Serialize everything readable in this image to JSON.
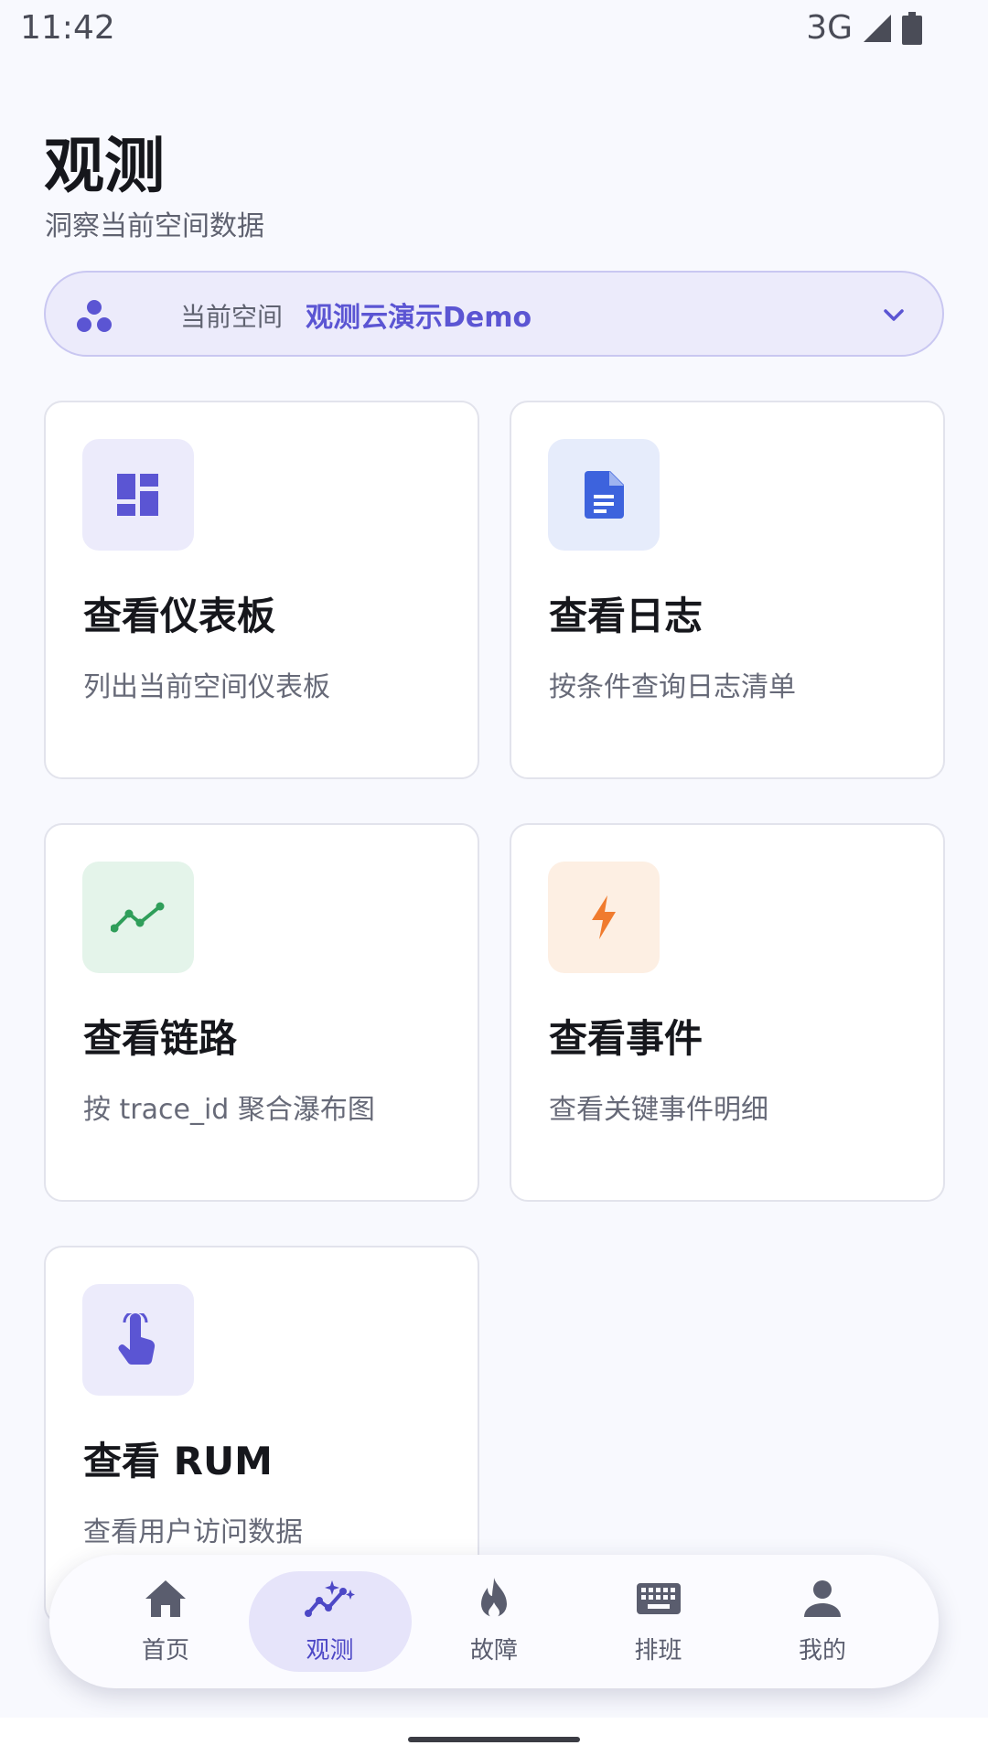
{
  "status_bar": {
    "time": "11:42",
    "network": "3G"
  },
  "header": {
    "title": "观测",
    "subtitle": "洞察当前空间数据"
  },
  "space_selector": {
    "label": "当前空间",
    "name": "观测云演示Demo",
    "accent_color": "#5b55d3"
  },
  "cards": [
    {
      "title": "查看仪表板",
      "desc": "列出当前空间仪表板",
      "icon": "dashboard-icon",
      "icon_color": "#5b55d3",
      "icon_bg": "#ecebfb"
    },
    {
      "title": "查看日志",
      "desc": "按条件查询日志清单",
      "icon": "document-icon",
      "icon_color": "#3d63dd",
      "icon_bg": "#e6ecfb"
    },
    {
      "title": "查看链路",
      "desc": "按 trace_id 聚合瀑布图",
      "icon": "trend-line-icon",
      "icon_color": "#2f9e5a",
      "icon_bg": "#e4f4ea"
    },
    {
      "title": "查看事件",
      "desc": "查看关键事件明细",
      "icon": "lightning-icon",
      "icon_color": "#f07b2e",
      "icon_bg": "#fdefe3"
    },
    {
      "title": "查看 RUM",
      "desc": "查看用户访问数据",
      "icon": "touch-icon",
      "icon_color": "#5b55d3",
      "icon_bg": "#ecebfb"
    }
  ],
  "bottom_nav": {
    "items": [
      {
        "label": "首页",
        "icon": "home-icon"
      },
      {
        "label": "观测",
        "icon": "sparkle-chart-icon",
        "active": true
      },
      {
        "label": "故障",
        "icon": "fire-icon"
      },
      {
        "label": "排班",
        "icon": "keyboard-icon"
      },
      {
        "label": "我的",
        "icon": "person-icon"
      }
    ]
  }
}
